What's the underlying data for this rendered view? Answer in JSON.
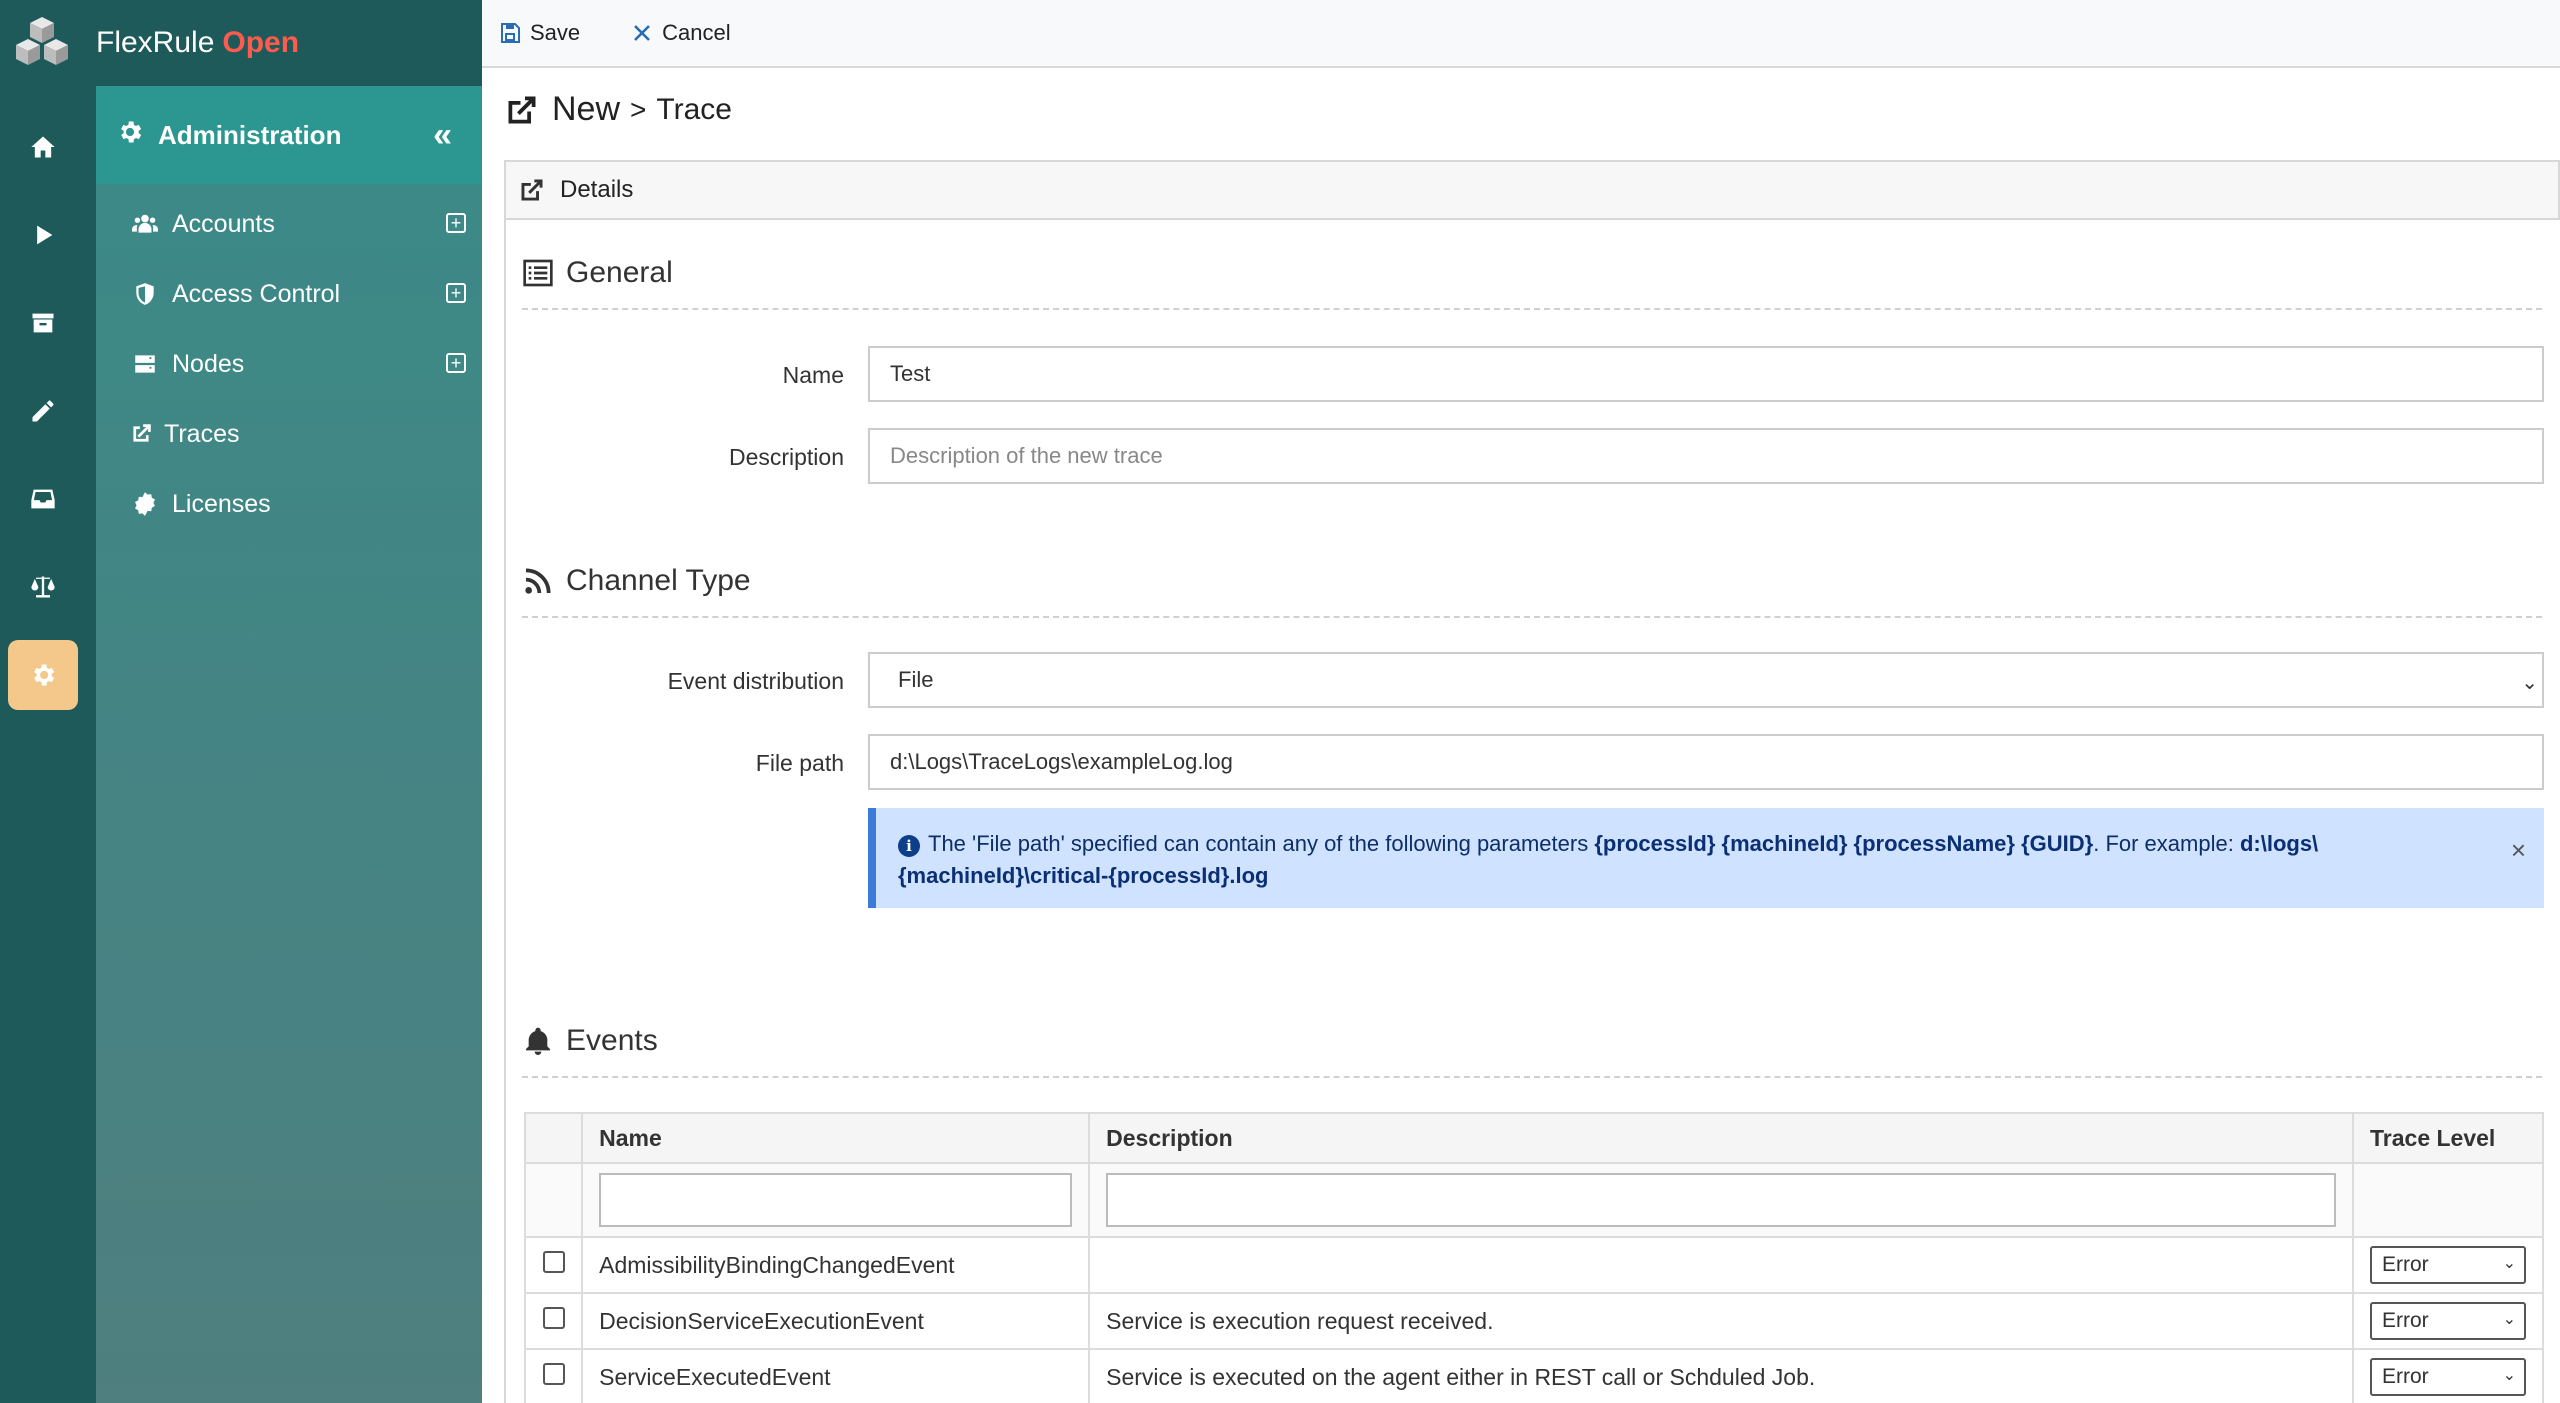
{
  "brand": {
    "name": "FlexRule",
    "accent": "Open"
  },
  "rail": {
    "items": [
      "home-icon",
      "play-icon",
      "archive-icon",
      "pencil-icon",
      "inbox-icon",
      "balance-scale-icon",
      "settings-icon"
    ],
    "active": "settings-icon"
  },
  "sidebar": {
    "title": "Administration",
    "items": [
      {
        "label": "Accounts",
        "icon": "users-icon",
        "expandable": true
      },
      {
        "label": "Access Control",
        "icon": "shield-icon",
        "expandable": true
      },
      {
        "label": "Nodes",
        "icon": "server-icon",
        "expandable": true
      },
      {
        "label": "Traces",
        "icon": "external-link-icon",
        "expandable": false
      },
      {
        "label": "Licenses",
        "icon": "certificate-icon",
        "expandable": false
      }
    ]
  },
  "toolbar": {
    "save_label": "Save",
    "cancel_label": "Cancel"
  },
  "page": {
    "title": "New",
    "separator": ">",
    "subtitle": "Trace"
  },
  "details": {
    "label": "Details"
  },
  "general": {
    "heading": "General",
    "name_label": "Name",
    "name_value": "Test",
    "description_label": "Description",
    "description_placeholder": "Description of the new trace"
  },
  "channel": {
    "heading": "Channel Type",
    "distribution_label": "Event distribution",
    "distribution_value": "File",
    "filepath_label": "File path",
    "filepath_value": "d:\\Logs\\TraceLogs\\exampleLog.log",
    "alert_prefix": "The 'File path' specified can contain any of the following parameters",
    "alert_params": "{processId} {machineId} {processName} {GUID}",
    "alert_mid": ". For example:",
    "alert_example_1": "d:\\logs\\",
    "alert_example_2": "{machineId}\\critical-{processId}.log"
  },
  "events": {
    "heading": "Events",
    "columns": [
      "Name",
      "Description",
      "Trace Level"
    ],
    "rows": [
      {
        "name": "AdmissibilityBindingChangedEvent",
        "description": "",
        "level": "Error"
      },
      {
        "name": "DecisionServiceExecutionEvent",
        "description": "Service is execution request received.",
        "level": "Error"
      },
      {
        "name": "ServiceExecutedEvent",
        "description": "Service is executed on the agent either in REST call or Schduled Job.",
        "level": "Error"
      }
    ]
  },
  "colors": {
    "rail": "#1e5a5a",
    "sidebar_head": "#2b9790",
    "active_rail": "#f4c78a",
    "brand_accent": "#ff5a4e",
    "alert_bg": "#cfe2ff"
  }
}
